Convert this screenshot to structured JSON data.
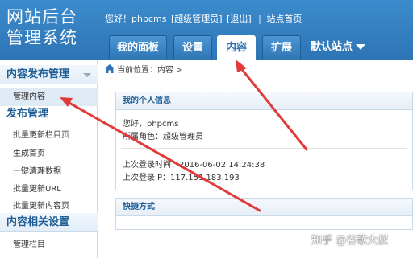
{
  "header": {
    "logo_line1": "网站后台",
    "logo_line2": "管理系统",
    "greeting": "您好！phpcms",
    "role": "[超级管理员]",
    "logout": "[退出]",
    "sep": "|",
    "site_home": "站点首页"
  },
  "nav": {
    "tabs": [
      {
        "label": "我的面板"
      },
      {
        "label": "设置"
      },
      {
        "label": "内容"
      },
      {
        "label": "扩展"
      }
    ],
    "site_select": "默认站点"
  },
  "sidebar": {
    "sections": [
      {
        "title": "内容发布管理"
      },
      {
        "title": "发布管理"
      },
      {
        "title": "内容相关设置"
      }
    ],
    "items": [
      {
        "label": "管理内容"
      },
      {
        "label": "批量更新栏目页"
      },
      {
        "label": "生成首页"
      },
      {
        "label": "一键清理数据"
      },
      {
        "label": "批量更新URL"
      },
      {
        "label": "批量更新内容页"
      },
      {
        "label": "管理栏目"
      }
    ]
  },
  "breadcrumb": "当前位置：内容 >",
  "info_panel": {
    "title": "我的个人信息",
    "hello": "您好，phpcms",
    "role": "所属角色：超级管理员",
    "last_time": "上次登录时间：2016-06-02 14:24:38",
    "last_ip": "上次登录IP：117.151.183.193"
  },
  "shortcut_panel": {
    "title": "快捷方式"
  },
  "watermark": "知乎 @谷歌大叔",
  "colors": {
    "header_blue": "#2e74b5",
    "arrow_red": "#e03a3a"
  }
}
